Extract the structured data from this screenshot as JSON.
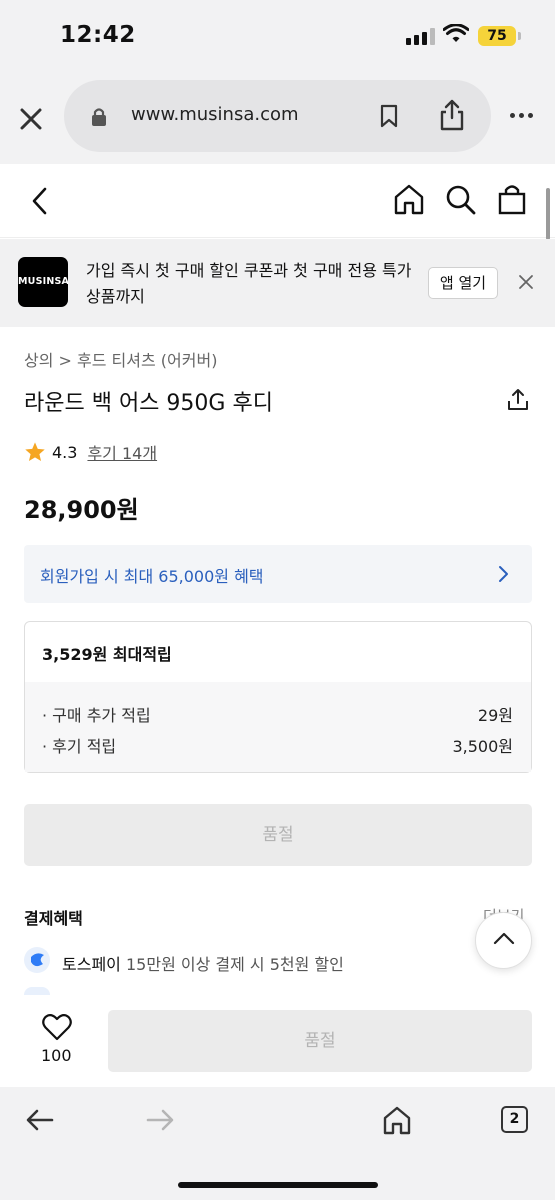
{
  "status_bar": {
    "time": "12:42",
    "battery": "75",
    "battery_color": "#f5d33a"
  },
  "browser": {
    "url": "www.musinsa.com"
  },
  "app_banner": {
    "logo_text": "MUSINSA",
    "message": "가입 즉시 첫 구매 할인 쿠폰과 첫 구매 전용 특가 상품까지",
    "open_label": "앱 열기"
  },
  "product": {
    "breadcrumb": "상의 > 후드 티셔츠 (어커버)",
    "title": "라운드 백 어스 950G 후디",
    "rating": "4.3",
    "review_link": "후기 14개",
    "price": "28,900원"
  },
  "benefit": {
    "text": "회원가입 시 최대 65,000원 혜택",
    "color": "#2a5fbd"
  },
  "points": {
    "title": "3,529원 최대적립",
    "rows": [
      {
        "label": "· 구매 추가 적립",
        "value": "29원"
      },
      {
        "label": "· 후기 적립",
        "value": "3,500원"
      }
    ]
  },
  "soldout_label": "품절",
  "payment": {
    "title": "결제혜택",
    "more": "더보기",
    "items": [
      {
        "brand": "토스페이",
        "desc": "15만원 이상 결제 시 5천원 할인"
      }
    ]
  },
  "purchase_bar": {
    "like_count": "100",
    "button_label": "품절"
  },
  "toolbar": {
    "tab_count": "2"
  }
}
